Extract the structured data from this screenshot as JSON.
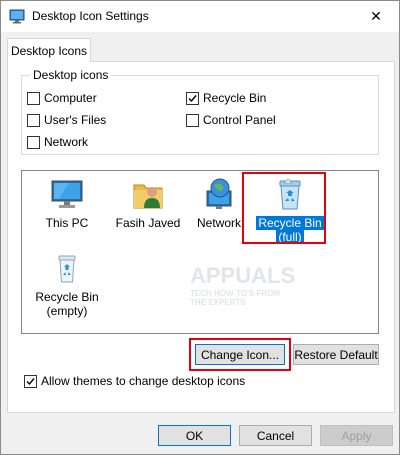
{
  "window": {
    "title": "Desktop Icon Settings",
    "close_glyph": "✕"
  },
  "tabs": [
    {
      "label": "Desktop Icons"
    }
  ],
  "desktop_icons_group": {
    "legend": "Desktop icons",
    "checkboxes": [
      {
        "label": "Computer",
        "checked": false
      },
      {
        "label": "Recycle Bin",
        "checked": true
      },
      {
        "label": "User's Files",
        "checked": false
      },
      {
        "label": "Control Panel",
        "checked": false
      },
      {
        "label": "Network",
        "checked": false
      }
    ]
  },
  "icon_list": {
    "items": [
      {
        "label": "This PC",
        "icon": "monitor-icon",
        "selected": false
      },
      {
        "label": "Fasih Javed",
        "icon": "user-folder-icon",
        "selected": false
      },
      {
        "label": "Network",
        "icon": "network-globe-icon",
        "selected": false
      },
      {
        "label_line1": "Recycle Bin",
        "label_line2": "(full)",
        "icon": "recycle-bin-full-icon",
        "selected": true
      },
      {
        "label_line1": "Recycle Bin",
        "label_line2": "(empty)",
        "icon": "recycle-bin-empty-icon",
        "selected": false
      }
    ]
  },
  "buttons": {
    "change_icon": "Change Icon...",
    "restore_default": "Restore Default",
    "ok": "OK",
    "cancel": "Cancel",
    "apply": "Apply"
  },
  "allow_themes": {
    "label": "Allow themes to change desktop icons",
    "checked": true
  },
  "watermark": {
    "line1": "APPUALS",
    "line2": "TECH HOW-TO'S FROM",
    "line3": "THE EXPERTS"
  },
  "colors": {
    "selection_blue": "#0078d7",
    "highlight_red": "#e3000f"
  }
}
